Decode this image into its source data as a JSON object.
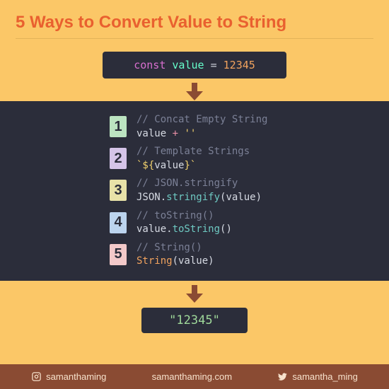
{
  "title": "5 Ways to Convert Value to String",
  "const_declaration": {
    "keyword": "const",
    "variable": "value",
    "equals": "=",
    "number": "12345"
  },
  "ways": [
    {
      "num": "1",
      "badge_class": "bg1",
      "comment": "// Concat Empty String",
      "code_html": "value <span class='pink'>+</span> <span class='yellow'>''</span>"
    },
    {
      "num": "2",
      "badge_class": "bg2",
      "comment": "// Template Strings",
      "code_html": "<span class='yellow'>`${</span>value<span class='yellow'>}`</span>"
    },
    {
      "num": "3",
      "badge_class": "bg3",
      "comment": "// JSON.stringify",
      "code_html": "JSON.<span class='teal'>stringify</span>(value)"
    },
    {
      "num": "4",
      "badge_class": "bg4",
      "comment": "// toString()",
      "code_html": "value.<span class='teal'>toString</span>()"
    },
    {
      "num": "5",
      "badge_class": "bg5",
      "comment": "// String()",
      "code_html": "<span class='orange'>String</span>(value)"
    }
  ],
  "result": "\"12345\"",
  "footer": {
    "instagram": "samanthaming",
    "website": "samanthaming.com",
    "twitter": "samantha_ming"
  }
}
